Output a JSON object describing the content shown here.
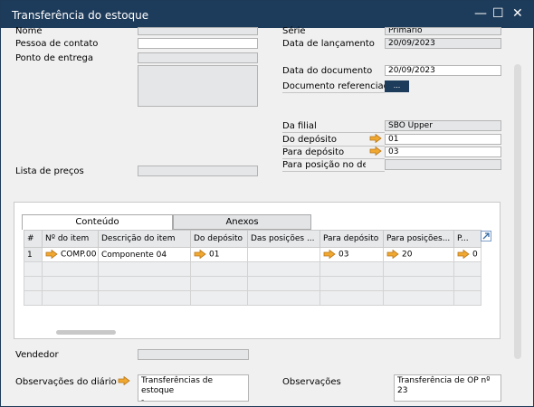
{
  "window": {
    "title": "Transferência do estoque",
    "minimize": "—",
    "maximize": "☐",
    "close": "✕"
  },
  "left": {
    "nome_label": "Nome",
    "pessoa_label": "Pessoa de contato",
    "ponto_label": "Ponto de entrega",
    "lista_label": "Lista de preços",
    "vendedor_label": "Vendedor",
    "obs_diario_label": "Observações do diário",
    "obs_diario_value": "Transferências de estoque\n-"
  },
  "right": {
    "serie_label": "Série",
    "serie_value": "Primário",
    "data_lanc_label": "Data de lançamento",
    "data_lanc_value": "20/09/2023",
    "data_doc_label": "Data do documento",
    "data_doc_value": "20/09/2023",
    "doc_ref_label": "Documento referenciado",
    "doc_ref_button": "...",
    "filial_label": "Da filial",
    "filial_value": "SBO Upper",
    "do_dep_label": "Do depósito",
    "do_dep_value": "01",
    "para_dep_label": "Para depósito",
    "para_dep_value": "03",
    "para_pos_label": "Para posição no dep",
    "observacoes_label": "Observações",
    "observacoes_value": "Transferência de OP nº\n23"
  },
  "tabs": [
    {
      "label": "Conteúdo"
    },
    {
      "label": "Anexos"
    }
  ],
  "grid": {
    "columns": [
      "#",
      "Nº do item",
      "Descrição do item",
      "Do depósito",
      "Das posições ...",
      "Para depósito",
      "Para posições...",
      "P..."
    ],
    "rows": [
      {
        "num": "1",
        "item": "COMP.00",
        "descricao": "Componente 04",
        "do_deposito": "01",
        "das_posicoes": "",
        "para_deposito": "03",
        "para_posicoes": "20",
        "p": "0"
      }
    ]
  },
  "colors": {
    "titlebar": "#1d3b5a",
    "arrow": "#f0a830"
  }
}
